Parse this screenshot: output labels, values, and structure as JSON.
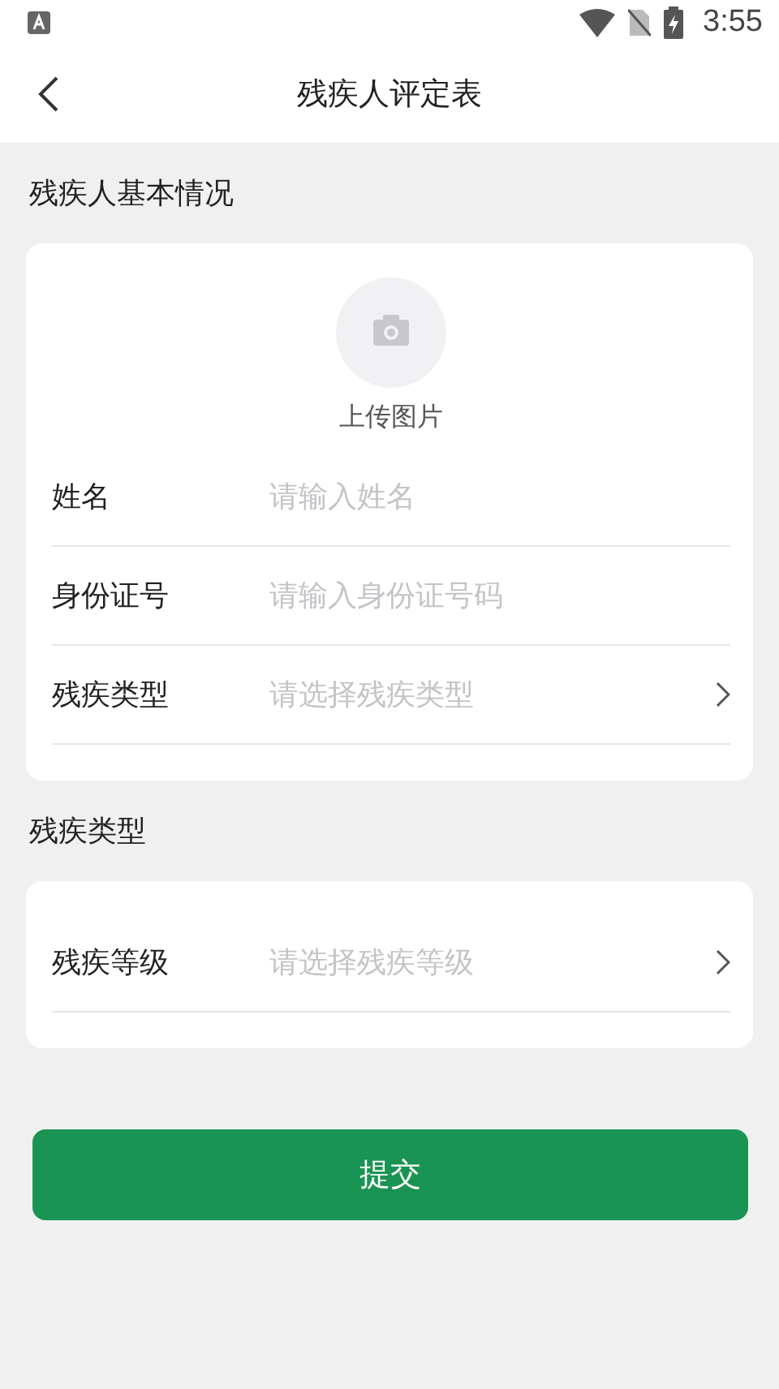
{
  "status_bar": {
    "time": "3:55"
  },
  "header": {
    "title": "残疾人评定表"
  },
  "sections": [
    {
      "title": "残疾人基本情况",
      "upload": {
        "label": "上传图片"
      },
      "fields": [
        {
          "kind": "input",
          "label": "姓名",
          "placeholder": "请输入姓名"
        },
        {
          "kind": "input",
          "label": "身份证号",
          "placeholder": "请输入身份证号码"
        },
        {
          "kind": "select",
          "label": "残疾类型",
          "placeholder": "请选择残疾类型"
        }
      ]
    },
    {
      "title": "残疾类型",
      "fields": [
        {
          "kind": "select",
          "label": "残疾等级",
          "placeholder": "请选择残疾等级"
        }
      ]
    }
  ],
  "submit": {
    "label": "提交"
  }
}
